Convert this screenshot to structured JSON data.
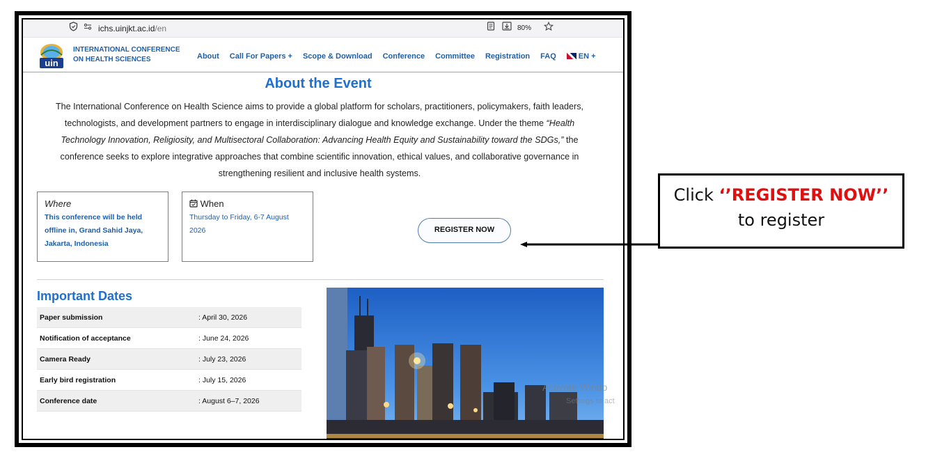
{
  "browser": {
    "url_domain": "ichs.uinjkt.ac.id",
    "url_path": "/en",
    "zoom": "80%"
  },
  "site": {
    "logo_text": "uin",
    "name_line1": "INTERNATIONAL CONFERENCE",
    "name_line2": "ON HEALTH SCIENCES",
    "nav": [
      "About",
      "Call For Papers +",
      "Scope & Download",
      "Conference",
      "Committee",
      "Registration",
      "FAQ"
    ],
    "lang": "EN +"
  },
  "event": {
    "title": "About the Event",
    "text_part1": "The International Conference on Health Science aims to provide a global platform for scholars, practitioners, policymakers, faith leaders, technologists, and development partners to engage in interdisciplinary dialogue and knowledge exchange. Under the theme ",
    "theme": "“Health Technology Innovation, Religiosity, and Multisectoral Collaboration: Advancing Health Equity and Sustainability toward the SDGs,”",
    "text_part2": " the conference seeks to explore integrative approaches that combine scientific innovation, ethical values, and collaborative governance in strengthening resilient and inclusive health systems."
  },
  "where": {
    "title": "Where",
    "body": "This conference will be held offline in, Grand Sahid Jaya, Jakarta, Indonesia"
  },
  "when": {
    "title": "When",
    "body": "Thursday to Friday, 6-7 August 2026"
  },
  "register_button": "REGISTER NOW",
  "dates": {
    "title": "Important Dates",
    "rows": [
      {
        "label": "Paper submission",
        "value": ": April 30, 2026"
      },
      {
        "label": "Notification of acceptance",
        "value": ": June 24, 2026"
      },
      {
        "label": "Camera Ready",
        "value": ": July 23, 2026"
      },
      {
        "label": "Early bird registration",
        "value": ": July 15, 2026"
      },
      {
        "label": "Conference date",
        "value": ": August 6–7, 2026"
      }
    ]
  },
  "watermark": {
    "line1": "Activate Windo",
    "line2": "Settings to act"
  },
  "annotation": {
    "prefix": "Click ",
    "highlight": "‘’REGISTER NOW’’",
    "line2": "to register",
    "highlight_color": "#e01010"
  }
}
